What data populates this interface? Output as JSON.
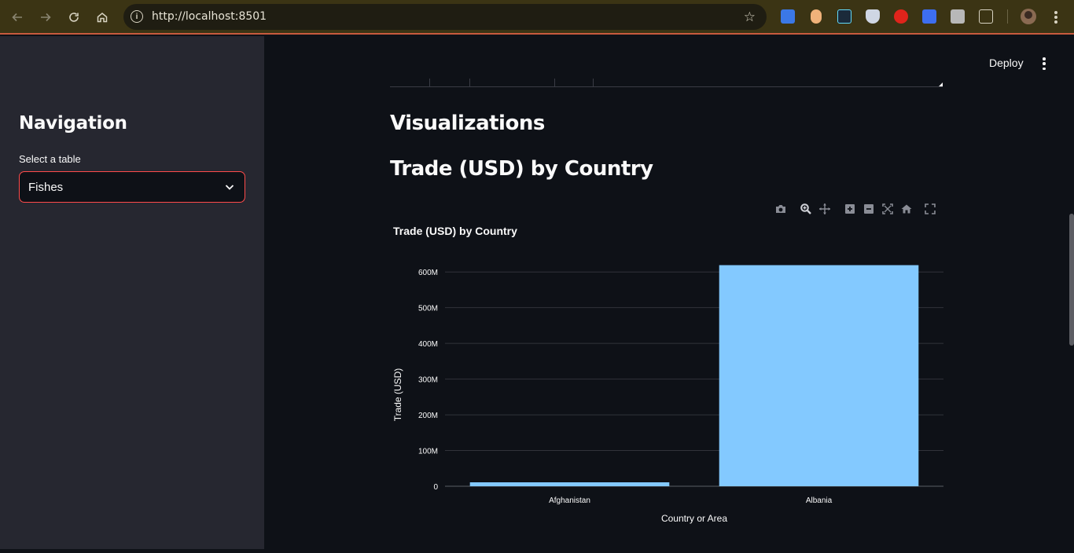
{
  "browser": {
    "url": "http://localhost:8501"
  },
  "sidebar": {
    "title": "Navigation",
    "select_label": "Select a table",
    "select_value": "Fishes"
  },
  "header": {
    "deploy_label": "Deploy"
  },
  "main": {
    "section_title": "Visualizations",
    "chart_heading": "Trade (USD) by Country"
  },
  "colors": {
    "accent": "#ff4b4b",
    "bar": "#83c9ff",
    "background": "#0e1117",
    "sidebar": "#262730"
  },
  "icons": {
    "modebar": [
      "camera-icon",
      "zoom-icon",
      "pan-icon",
      "zoom-in-icon",
      "zoom-out-icon",
      "autoscale-icon",
      "reset-axes-icon",
      "fullscreen-icon"
    ]
  },
  "chart_data": {
    "type": "bar",
    "title": "Trade (USD) by Country",
    "xlabel": "Country or Area",
    "ylabel": "Trade (USD)",
    "categories": [
      "Afghanistan",
      "Albania"
    ],
    "values": [
      11000000,
      619000000
    ],
    "ylim": [
      0,
      640000000
    ],
    "yticks": [
      0,
      100000000,
      200000000,
      300000000,
      400000000,
      500000000,
      600000000
    ],
    "ytick_labels": [
      "0",
      "100M",
      "200M",
      "300M",
      "400M",
      "500M",
      "600M"
    ],
    "grid": true,
    "legend": "none"
  }
}
